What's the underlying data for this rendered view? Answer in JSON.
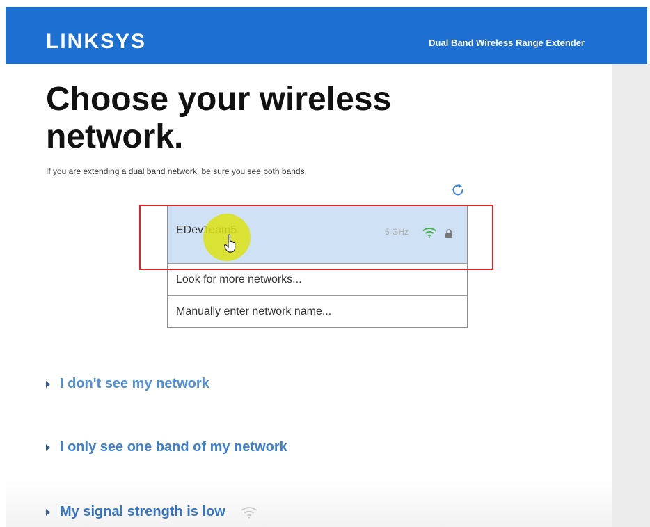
{
  "header": {
    "logo": "LINKSYS",
    "product": "Dual Band Wireless Range Extender"
  },
  "main": {
    "title": "Choose your wireless network.",
    "subtitle": "If you are extending a dual band network, be sure you see both bands.",
    "refresh_icon": "refresh-icon",
    "networks": [
      {
        "name": "EDevTeam5",
        "band": "5 GHz",
        "signal_icon": "wifi-icon",
        "secured_icon": "lock-icon",
        "selected": true
      }
    ],
    "options": [
      {
        "label": "Look for more networks..."
      },
      {
        "label": "Manually enter network name..."
      }
    ]
  },
  "help": {
    "items": [
      {
        "label": "I don't see my network"
      },
      {
        "label": "I only see one band of my network"
      },
      {
        "label": "My signal strength is low"
      }
    ]
  },
  "colors": {
    "brand": "#1d6fd1",
    "link": "#4a8bd8",
    "selected_row": "#cfe1f4",
    "highlight": "#e0242a"
  }
}
